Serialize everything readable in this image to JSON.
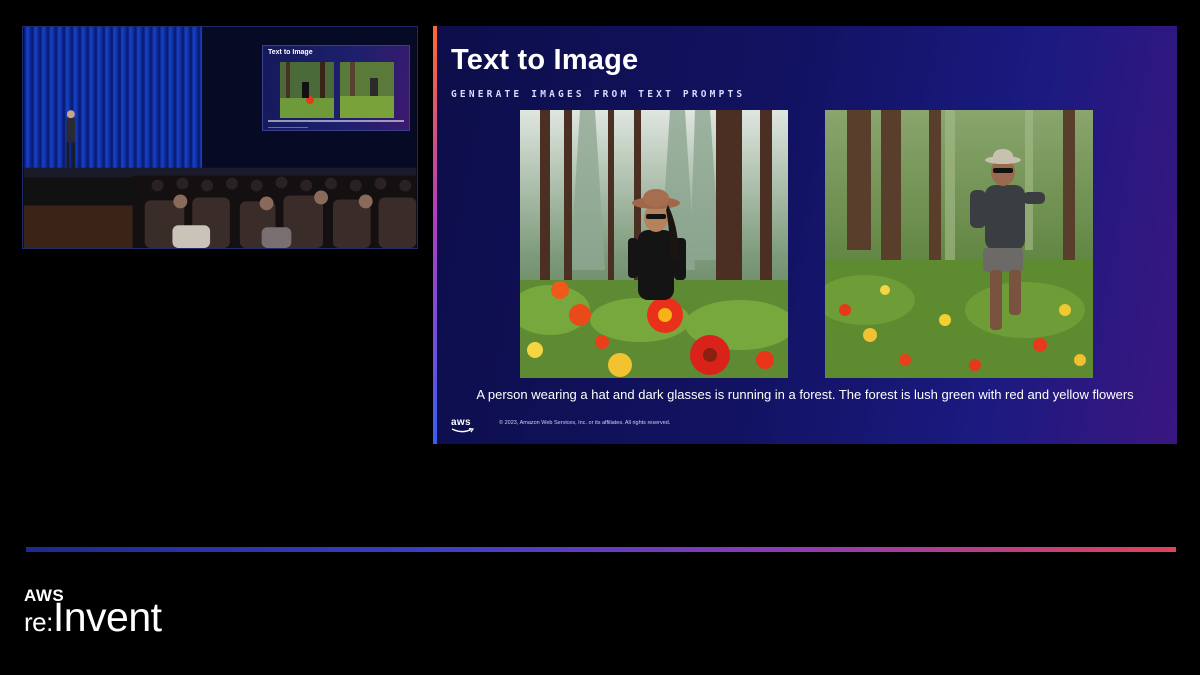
{
  "stage": {
    "mini_slide_title": "Text to Image"
  },
  "slide": {
    "title": "Text to Image",
    "subtitle": "GENERATE IMAGES FROM TEXT PROMPTS",
    "caption": "A person wearing a hat and dark glasses is running in a forest. The forest is lush green with red and yellow flowers",
    "logo_text": "aws",
    "copyright": "© 2023, Amazon Web Services, Inc. or its affiliates. All rights reserved."
  },
  "brand": {
    "aws": "AWS",
    "re": "re:",
    "invent": "Invent"
  },
  "colors": {
    "background": "#000000",
    "slide_bg": "#121262",
    "accent_orange": "#ff6a2f",
    "accent_blue": "#3a5ef5",
    "divider_purple": "#8a3bb8"
  }
}
